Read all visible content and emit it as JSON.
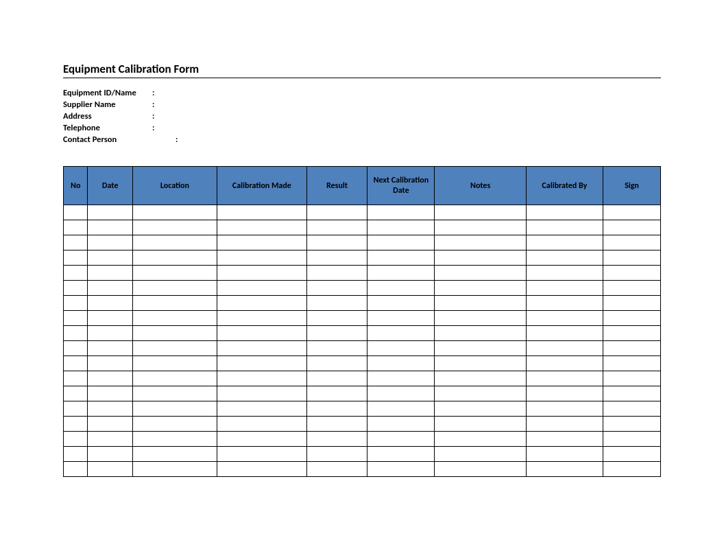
{
  "title": "Equipment Calibration Form",
  "meta": {
    "equipment_id": {
      "label": "Equipment ID/Name",
      "value": ""
    },
    "supplier_name": {
      "label": "Supplier Name",
      "value": ""
    },
    "address": {
      "label": "Address",
      "value": ""
    },
    "telephone": {
      "label": "Telephone",
      "value": ""
    },
    "contact_person": {
      "label": "Contact Person",
      "value": ""
    }
  },
  "colon": ":",
  "table": {
    "headers": {
      "no": "No",
      "date": "Date",
      "location": "Location",
      "calibration_made": "Calibration Made",
      "result": "Result",
      "next_calibration_date": "Next Calibration Date",
      "notes": "Notes",
      "calibrated_by": "Calibrated By",
      "sign": "Sign"
    },
    "row_count": 18,
    "rows": []
  },
  "colors": {
    "header_bg": "#4f81bd"
  }
}
